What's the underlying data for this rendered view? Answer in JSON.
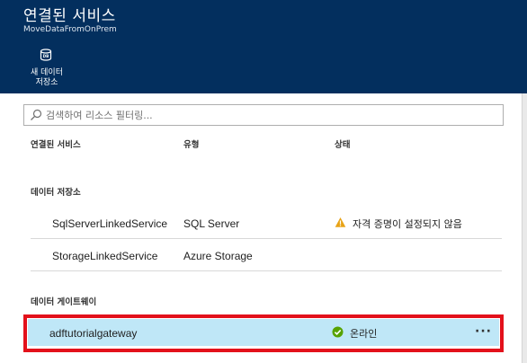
{
  "header": {
    "title": "연결된 서비스",
    "subtitle": "MoveDataFromOnPrem",
    "new_store_button": {
      "label": "새 데이터\n저장소",
      "icon": "database-icon"
    }
  },
  "search": {
    "placeholder": "검색하여 리소스 필터링..."
  },
  "columns": {
    "name": "연결된 서비스",
    "type": "유형",
    "status": "상태"
  },
  "sections": {
    "data_stores": {
      "label": "데이터 저장소",
      "rows": [
        {
          "name": "SqlServerLinkedService",
          "type": "SQL Server",
          "status": "자격 증명이 설정되지 않음",
          "status_icon": "warning-icon"
        },
        {
          "name": "StorageLinkedService",
          "type": "Azure Storage",
          "status": "",
          "status_icon": ""
        }
      ]
    },
    "gateways": {
      "label": "데이터 게이트웨이",
      "rows": [
        {
          "name": "adftutorialgateway",
          "status": "온라인",
          "status_icon": "check-circle-icon",
          "more": "···"
        }
      ]
    }
  },
  "colors": {
    "header_bg": "#032f5e",
    "selected_row_bg": "#bfe7f7",
    "highlight_border": "#e3111b",
    "warning": "#e8a317",
    "online": "#57a300"
  }
}
